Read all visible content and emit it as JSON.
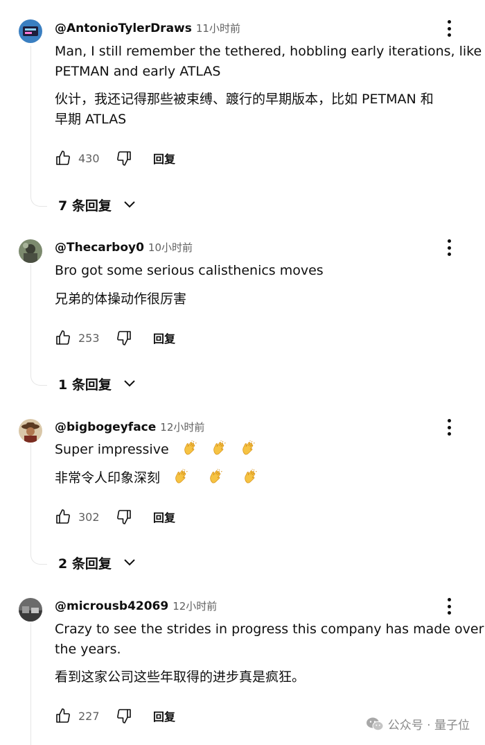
{
  "comments": [
    {
      "author": "@AntonioTylerDraws",
      "time": "11小时前",
      "text_en": [
        "Man, I still remember the tethered, hobbling early iterations, like",
        "PETMAN and early ATLAS"
      ],
      "text_cn": [
        "伙计，我还记得那些被束缚、踱行的早期版本，比如 PETMAN 和",
        "早期 ATLAS"
      ],
      "likes": "430",
      "reply_label": "回复",
      "replies_label": "7 条回复"
    },
    {
      "author": "@Thecarboy0",
      "time": "10小时前",
      "text_en": [
        "Bro got some serious calisthenics moves"
      ],
      "text_cn": [
        "兄弟的体操动作很厉害"
      ],
      "likes": "253",
      "reply_label": "回复",
      "replies_label": "1 条回复"
    },
    {
      "author": "@bigbogeyface",
      "time": "12小时前",
      "text_en": [
        "Super impressive"
      ],
      "text_cn": [
        "非常令人印象深刻"
      ],
      "emoji": "clapping-hands",
      "likes": "302",
      "reply_label": "回复",
      "replies_label": "2 条回复"
    },
    {
      "author": "@microusb42069",
      "time": "12小时前",
      "text_en": [
        "Crazy to see the strides in progress this company has made over",
        "the years."
      ],
      "text_cn": [
        "看到这家公司这些年取得的进步真是疯狂。"
      ],
      "likes": "227",
      "reply_label": "回复"
    }
  ],
  "watermark": {
    "dot_text": "公众号 · 量子位",
    "icon": "wechat-icon"
  },
  "colors": {
    "text": "#0f0f0f",
    "secondary": "#606060",
    "thread_line": "#e5e5e5"
  }
}
